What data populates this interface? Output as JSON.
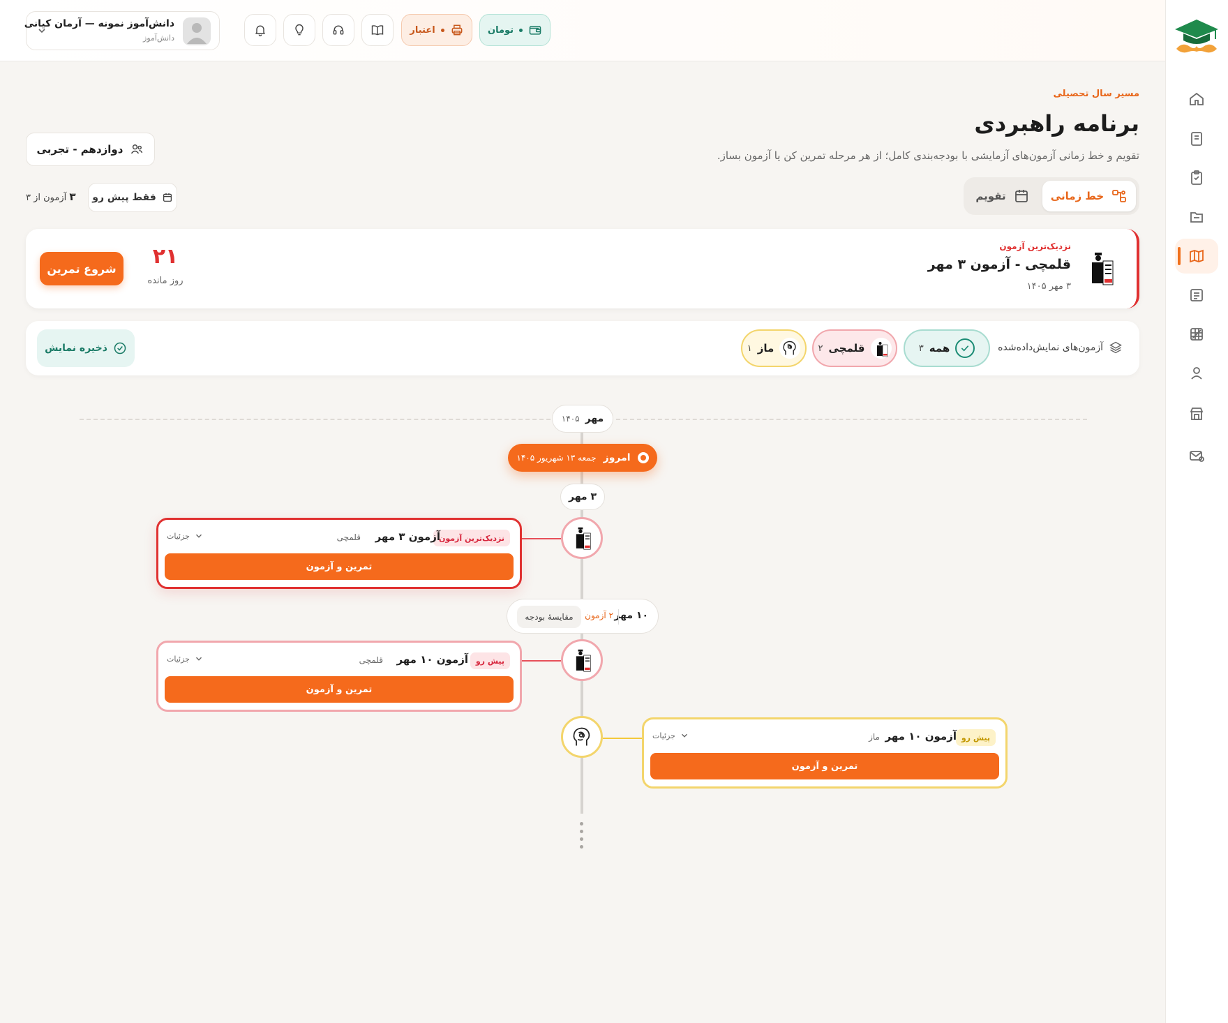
{
  "brand": {
    "accent": "#f56a1c",
    "danger": "#e03131",
    "success": "#1a7b66",
    "warning": "#f3d56c"
  },
  "user": {
    "name": "دانش‌آموز نمونه — آرمان کیانی",
    "role": "دانش‌آموز"
  },
  "header": {
    "credit_label": "اعتبار",
    "toman_label": "تومان",
    "icons": [
      "bell-icon",
      "lightbulb-icon",
      "headset-icon",
      "book-open-icon",
      "printer-icon",
      "wallet-icon"
    ]
  },
  "sidebar": {
    "items": [
      {
        "name": "home-icon",
        "active": false
      },
      {
        "name": "book-icon",
        "active": false
      },
      {
        "name": "clipboard-check-icon",
        "active": false
      },
      {
        "name": "file-text-icon",
        "active": false
      },
      {
        "name": "map-icon",
        "active": true
      },
      {
        "name": "newspaper-icon",
        "active": false
      },
      {
        "name": "grid-chart-icon",
        "active": false
      },
      {
        "name": "user-icon",
        "active": false
      },
      {
        "name": "store-icon",
        "active": false
      },
      {
        "name": "mail-badge-icon",
        "active": false
      }
    ]
  },
  "page": {
    "breadcrumb": "مسیر سال تحصیلی",
    "title": "برنامه راهبردی",
    "subtitle": "تقویم و خط زمانی آزمون‌های آزمایشی با بودجه‌بندی کامل؛ از هر مرحله تمرین کن یا آزمون بساز.",
    "grade": "دوازدهم - تجربی"
  },
  "view_toggle": {
    "timeline": "خط زمانی",
    "calendar": "تقویم",
    "selected": "timeline"
  },
  "filter_summary": {
    "upcoming_only": "فقط پیش رو",
    "count_prefix": "۳",
    "count_suffix": "آزمون از ۳"
  },
  "next_exam": {
    "kicker": "نزدیک‌ترین آزمون",
    "title": "قلمچی - آزمون ۳ مهر",
    "date": "۳ مهر ۱۴۰۵",
    "days": "۲۱",
    "days_label": "روز مانده",
    "start_button": "شروع تمرین"
  },
  "filters": {
    "label": "آزمون‌های نمایش‌داده‌شده",
    "chips": [
      {
        "label": "همه",
        "count": "۳"
      },
      {
        "label": "قلمچی",
        "count": "۲"
      },
      {
        "label": "ماز",
        "count": "۱"
      }
    ],
    "save_label": "ذخیره نمایش"
  },
  "timeline": {
    "month": {
      "name": "مهر",
      "year": "۱۴۰۵"
    },
    "today": {
      "label": "امروز",
      "date": "جمعه ۱۳ شهریور ۱۴۰۵"
    },
    "date_groups": [
      {
        "date": "۳ مهر"
      },
      {
        "date": "۱۰ مهر",
        "count": "۲ آزمون",
        "compare": "مقایسهٔ بودجه"
      }
    ],
    "exams": [
      {
        "tag": "نزدیک‌ترین آزمون",
        "title": "آزمون ۳ مهر",
        "source": "قلمچی",
        "details": "جزئیات",
        "button": "تمرین و آزمون"
      },
      {
        "tag": "پیش رو",
        "title": "آزمون ۱۰ مهر",
        "source": "قلمچی",
        "details": "جزئیات",
        "button": "تمرین و آزمون"
      },
      {
        "tag": "پیش رو",
        "title": "آزمون ۱۰ مهر",
        "source": "ماز",
        "details": "جزئیات",
        "button": "تمرین و آزمون"
      }
    ]
  }
}
